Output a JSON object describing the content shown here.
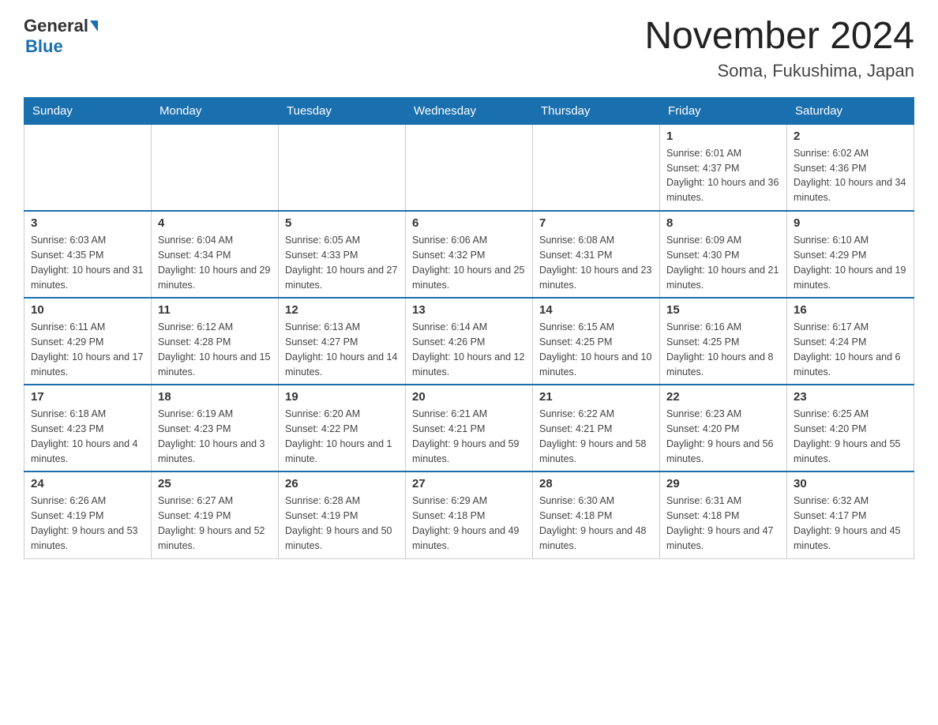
{
  "header": {
    "logo_general": "General",
    "logo_blue": "Blue",
    "title": "November 2024",
    "subtitle": "Soma, Fukushima, Japan"
  },
  "days_of_week": [
    "Sunday",
    "Monday",
    "Tuesday",
    "Wednesday",
    "Thursday",
    "Friday",
    "Saturday"
  ],
  "weeks": [
    {
      "days": [
        {
          "num": "",
          "info": ""
        },
        {
          "num": "",
          "info": ""
        },
        {
          "num": "",
          "info": ""
        },
        {
          "num": "",
          "info": ""
        },
        {
          "num": "",
          "info": ""
        },
        {
          "num": "1",
          "info": "Sunrise: 6:01 AM\nSunset: 4:37 PM\nDaylight: 10 hours and 36 minutes."
        },
        {
          "num": "2",
          "info": "Sunrise: 6:02 AM\nSunset: 4:36 PM\nDaylight: 10 hours and 34 minutes."
        }
      ]
    },
    {
      "days": [
        {
          "num": "3",
          "info": "Sunrise: 6:03 AM\nSunset: 4:35 PM\nDaylight: 10 hours and 31 minutes."
        },
        {
          "num": "4",
          "info": "Sunrise: 6:04 AM\nSunset: 4:34 PM\nDaylight: 10 hours and 29 minutes."
        },
        {
          "num": "5",
          "info": "Sunrise: 6:05 AM\nSunset: 4:33 PM\nDaylight: 10 hours and 27 minutes."
        },
        {
          "num": "6",
          "info": "Sunrise: 6:06 AM\nSunset: 4:32 PM\nDaylight: 10 hours and 25 minutes."
        },
        {
          "num": "7",
          "info": "Sunrise: 6:08 AM\nSunset: 4:31 PM\nDaylight: 10 hours and 23 minutes."
        },
        {
          "num": "8",
          "info": "Sunrise: 6:09 AM\nSunset: 4:30 PM\nDaylight: 10 hours and 21 minutes."
        },
        {
          "num": "9",
          "info": "Sunrise: 6:10 AM\nSunset: 4:29 PM\nDaylight: 10 hours and 19 minutes."
        }
      ]
    },
    {
      "days": [
        {
          "num": "10",
          "info": "Sunrise: 6:11 AM\nSunset: 4:29 PM\nDaylight: 10 hours and 17 minutes."
        },
        {
          "num": "11",
          "info": "Sunrise: 6:12 AM\nSunset: 4:28 PM\nDaylight: 10 hours and 15 minutes."
        },
        {
          "num": "12",
          "info": "Sunrise: 6:13 AM\nSunset: 4:27 PM\nDaylight: 10 hours and 14 minutes."
        },
        {
          "num": "13",
          "info": "Sunrise: 6:14 AM\nSunset: 4:26 PM\nDaylight: 10 hours and 12 minutes."
        },
        {
          "num": "14",
          "info": "Sunrise: 6:15 AM\nSunset: 4:25 PM\nDaylight: 10 hours and 10 minutes."
        },
        {
          "num": "15",
          "info": "Sunrise: 6:16 AM\nSunset: 4:25 PM\nDaylight: 10 hours and 8 minutes."
        },
        {
          "num": "16",
          "info": "Sunrise: 6:17 AM\nSunset: 4:24 PM\nDaylight: 10 hours and 6 minutes."
        }
      ]
    },
    {
      "days": [
        {
          "num": "17",
          "info": "Sunrise: 6:18 AM\nSunset: 4:23 PM\nDaylight: 10 hours and 4 minutes."
        },
        {
          "num": "18",
          "info": "Sunrise: 6:19 AM\nSunset: 4:23 PM\nDaylight: 10 hours and 3 minutes."
        },
        {
          "num": "19",
          "info": "Sunrise: 6:20 AM\nSunset: 4:22 PM\nDaylight: 10 hours and 1 minute."
        },
        {
          "num": "20",
          "info": "Sunrise: 6:21 AM\nSunset: 4:21 PM\nDaylight: 9 hours and 59 minutes."
        },
        {
          "num": "21",
          "info": "Sunrise: 6:22 AM\nSunset: 4:21 PM\nDaylight: 9 hours and 58 minutes."
        },
        {
          "num": "22",
          "info": "Sunrise: 6:23 AM\nSunset: 4:20 PM\nDaylight: 9 hours and 56 minutes."
        },
        {
          "num": "23",
          "info": "Sunrise: 6:25 AM\nSunset: 4:20 PM\nDaylight: 9 hours and 55 minutes."
        }
      ]
    },
    {
      "days": [
        {
          "num": "24",
          "info": "Sunrise: 6:26 AM\nSunset: 4:19 PM\nDaylight: 9 hours and 53 minutes."
        },
        {
          "num": "25",
          "info": "Sunrise: 6:27 AM\nSunset: 4:19 PM\nDaylight: 9 hours and 52 minutes."
        },
        {
          "num": "26",
          "info": "Sunrise: 6:28 AM\nSunset: 4:19 PM\nDaylight: 9 hours and 50 minutes."
        },
        {
          "num": "27",
          "info": "Sunrise: 6:29 AM\nSunset: 4:18 PM\nDaylight: 9 hours and 49 minutes."
        },
        {
          "num": "28",
          "info": "Sunrise: 6:30 AM\nSunset: 4:18 PM\nDaylight: 9 hours and 48 minutes."
        },
        {
          "num": "29",
          "info": "Sunrise: 6:31 AM\nSunset: 4:18 PM\nDaylight: 9 hours and 47 minutes."
        },
        {
          "num": "30",
          "info": "Sunrise: 6:32 AM\nSunset: 4:17 PM\nDaylight: 9 hours and 45 minutes."
        }
      ]
    }
  ]
}
